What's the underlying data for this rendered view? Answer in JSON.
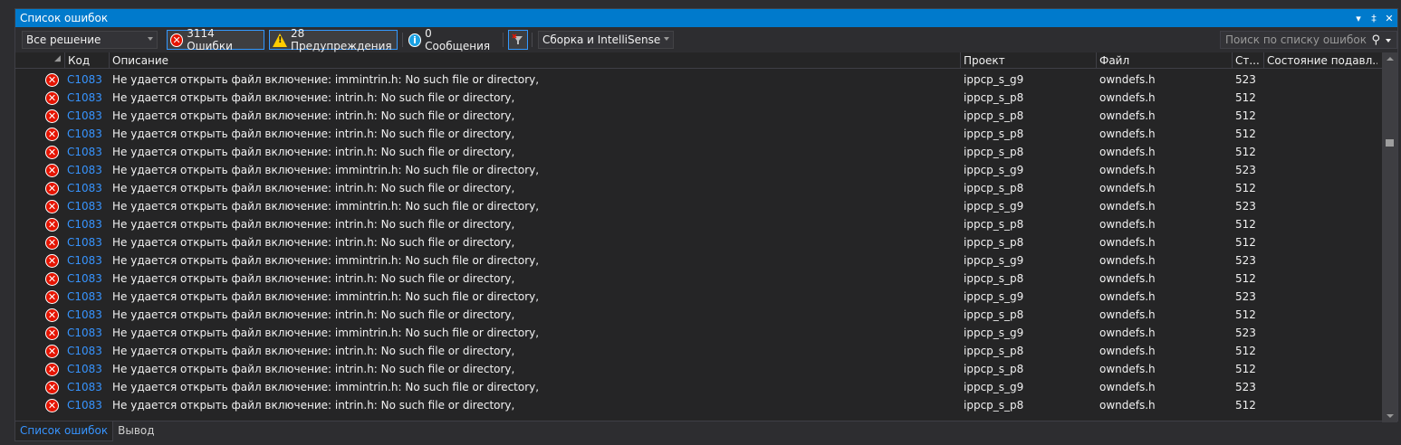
{
  "panel": {
    "title": "Список ошибок"
  },
  "toolbar": {
    "scope_value": "Все решение",
    "errors_label": "3114 Ошибки",
    "warnings_label": "28 Предупреждения",
    "messages_label": "0 Сообщения",
    "source_value": "Сборка и IntelliSense",
    "search_placeholder": "Поиск по списку ошибок"
  },
  "columns": {
    "code": "Код",
    "description": "Описание",
    "project": "Проект",
    "file": "Файл",
    "line": "Ст...",
    "suppression": "Состояние подавл..."
  },
  "rows": [
    {
      "code": "C1083",
      "description": "Не удается открыть файл включение: immintrin.h: No such file or directory,",
      "project": "ippcp_s_g9",
      "file": "owndefs.h",
      "line": "523"
    },
    {
      "code": "C1083",
      "description": "Не удается открыть файл включение: intrin.h: No such file or directory,",
      "project": "ippcp_s_p8",
      "file": "owndefs.h",
      "line": "512"
    },
    {
      "code": "C1083",
      "description": "Не удается открыть файл включение: intrin.h: No such file or directory,",
      "project": "ippcp_s_p8",
      "file": "owndefs.h",
      "line": "512"
    },
    {
      "code": "C1083",
      "description": "Не удается открыть файл включение: intrin.h: No such file or directory,",
      "project": "ippcp_s_p8",
      "file": "owndefs.h",
      "line": "512"
    },
    {
      "code": "C1083",
      "description": "Не удается открыть файл включение: intrin.h: No such file or directory,",
      "project": "ippcp_s_p8",
      "file": "owndefs.h",
      "line": "512"
    },
    {
      "code": "C1083",
      "description": "Не удается открыть файл включение: immintrin.h: No such file or directory,",
      "project": "ippcp_s_g9",
      "file": "owndefs.h",
      "line": "523"
    },
    {
      "code": "C1083",
      "description": "Не удается открыть файл включение: intrin.h: No such file or directory,",
      "project": "ippcp_s_p8",
      "file": "owndefs.h",
      "line": "512"
    },
    {
      "code": "C1083",
      "description": "Не удается открыть файл включение: immintrin.h: No such file or directory,",
      "project": "ippcp_s_g9",
      "file": "owndefs.h",
      "line": "523"
    },
    {
      "code": "C1083",
      "description": "Не удается открыть файл включение: intrin.h: No such file or directory,",
      "project": "ippcp_s_p8",
      "file": "owndefs.h",
      "line": "512"
    },
    {
      "code": "C1083",
      "description": "Не удается открыть файл включение: intrin.h: No such file or directory,",
      "project": "ippcp_s_p8",
      "file": "owndefs.h",
      "line": "512"
    },
    {
      "code": "C1083",
      "description": "Не удается открыть файл включение: immintrin.h: No such file or directory,",
      "project": "ippcp_s_g9",
      "file": "owndefs.h",
      "line": "523"
    },
    {
      "code": "C1083",
      "description": "Не удается открыть файл включение: intrin.h: No such file or directory,",
      "project": "ippcp_s_p8",
      "file": "owndefs.h",
      "line": "512"
    },
    {
      "code": "C1083",
      "description": "Не удается открыть файл включение: immintrin.h: No such file or directory,",
      "project": "ippcp_s_g9",
      "file": "owndefs.h",
      "line": "523"
    },
    {
      "code": "C1083",
      "description": "Не удается открыть файл включение: intrin.h: No such file or directory,",
      "project": "ippcp_s_p8",
      "file": "owndefs.h",
      "line": "512"
    },
    {
      "code": "C1083",
      "description": "Не удается открыть файл включение: immintrin.h: No such file or directory,",
      "project": "ippcp_s_g9",
      "file": "owndefs.h",
      "line": "523"
    },
    {
      "code": "C1083",
      "description": "Не удается открыть файл включение: intrin.h: No such file or directory,",
      "project": "ippcp_s_p8",
      "file": "owndefs.h",
      "line": "512"
    },
    {
      "code": "C1083",
      "description": "Не удается открыть файл включение: intrin.h: No such file or directory,",
      "project": "ippcp_s_p8",
      "file": "owndefs.h",
      "line": "512"
    },
    {
      "code": "C1083",
      "description": "Не удается открыть файл включение: immintrin.h: No such file or directory,",
      "project": "ippcp_s_g9",
      "file": "owndefs.h",
      "line": "523"
    },
    {
      "code": "C1083",
      "description": "Не удается открыть файл включение: intrin.h: No such file or directory,",
      "project": "ippcp_s_p8",
      "file": "owndefs.h",
      "line": "512"
    }
  ],
  "tabs": [
    {
      "label": "Список ошибок"
    },
    {
      "label": "Вывод"
    }
  ],
  "colors": {
    "accent": "#007acc",
    "link": "#3794ff",
    "error": "#e51400",
    "warning": "#ffcc00",
    "info": "#1ba1e2"
  }
}
